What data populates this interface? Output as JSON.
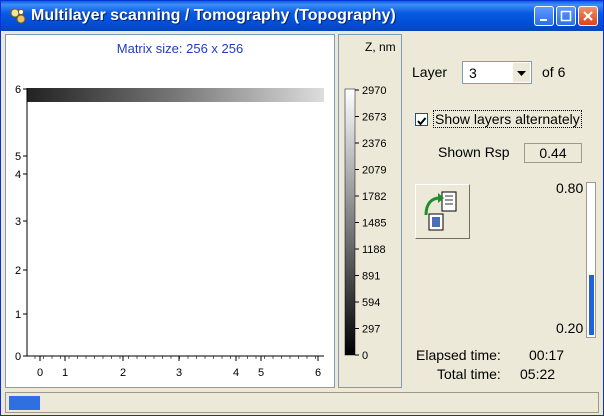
{
  "window": {
    "title": "Multilayer scanning / Tomography (Topography)"
  },
  "plot": {
    "matrix_size_text": "Matrix size: 256 x 256",
    "y_ticks": [
      "0",
      "1",
      "2",
      "3",
      "4",
      "5",
      "6"
    ],
    "x_ticks": [
      "0",
      "1",
      "2",
      "3",
      "4",
      "5",
      "6"
    ]
  },
  "colorbar": {
    "label_line1": "Z, nm",
    "ticks": [
      "2970",
      "2673",
      "2376",
      "2079",
      "1782",
      "1485",
      "1188",
      "891",
      "594",
      "297",
      "0"
    ]
  },
  "side": {
    "layer_label": "Layer",
    "layer_value": "3",
    "of_label": "of 6",
    "show_layers_label": "Show layers alternately",
    "show_layers_checked": true,
    "shown_rsp_label": "Shown Rsp",
    "shown_rsp_value": "0.44",
    "gauge_max": "0.80",
    "gauge_min": "0.20",
    "gauge_value": 0.44,
    "elapsed_label": "Elapsed time:",
    "elapsed_value": "00:17",
    "total_label": "Total time:",
    "total_value": "05:22"
  },
  "status": {
    "progress_fraction": 0.053
  },
  "colors": {
    "titlebar": "#0A5BE0",
    "accent": "#1F62D9",
    "axis_text": "#000000",
    "matrix_text": "#1E3CC8"
  }
}
